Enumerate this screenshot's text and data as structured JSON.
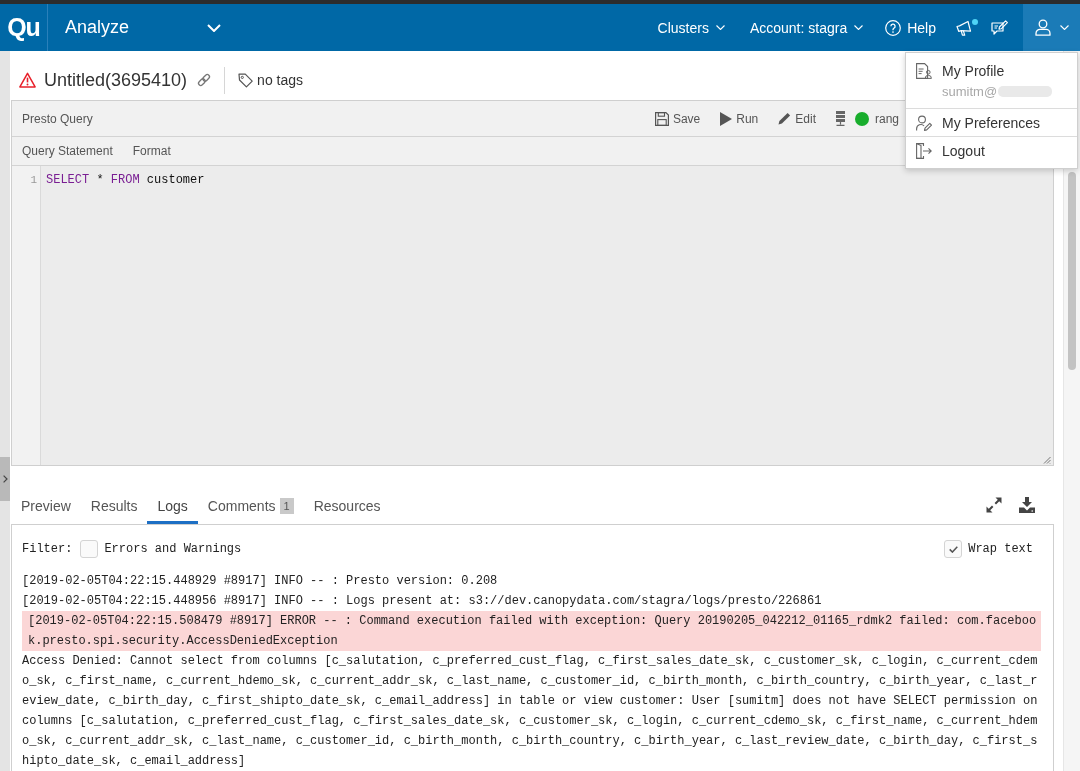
{
  "top_bar": {
    "logo": "Qu",
    "product": "Analyze",
    "menus": [
      {
        "label": "Clusters"
      },
      {
        "label": "Account: stagra"
      }
    ],
    "help": "Help",
    "unread_announcements": true
  },
  "command": {
    "failed": true,
    "title": "Untitled(3695410)",
    "tags": "no tags"
  },
  "editor": {
    "type": "Presto Query",
    "actions": [
      {
        "kind": "save",
        "label": "Save"
      },
      {
        "kind": "run",
        "label": "Run"
      },
      {
        "kind": "edit",
        "label": "Edit"
      }
    ],
    "cluster": {
      "running": true,
      "label": "rang"
    },
    "subtabs": [
      "Query Statement",
      "Format"
    ],
    "lines": [
      {
        "number": "1",
        "tokens": [
          {
            "kind": "keyword",
            "text": "SELECT"
          },
          {
            "kind": "plain",
            "text": " * "
          },
          {
            "kind": "keyword",
            "text": "FROM"
          },
          {
            "kind": "plain",
            "text": " customer"
          }
        ]
      }
    ]
  },
  "result_tabs": [
    {
      "label": "Preview",
      "selected": false
    },
    {
      "label": "Results",
      "selected": false
    },
    {
      "label": "Logs",
      "selected": true
    },
    {
      "label": "Comments",
      "selected": false,
      "badge": "1"
    },
    {
      "label": "Resources",
      "selected": false
    }
  ],
  "logs": {
    "filter_label": "Filter:",
    "errors_only": {
      "label": "Errors and Warnings",
      "checked": false
    },
    "wrap_text": {
      "label": "Wrap text",
      "checked": true
    },
    "entries": [
      {
        "kind": "info",
        "text": "[2019-02-05T04:22:15.448929 #8917] INFO -- : Presto version: 0.208"
      },
      {
        "kind": "info",
        "text": "[2019-02-05T04:22:15.448956 #8917] INFO -- : Logs present at: s3://dev.canopydata.com/stagra/logs/presto/226861"
      },
      {
        "kind": "error",
        "text": "[2019-02-05T04:22:15.508479 #8917] ERROR -- : Command execution failed with exception: Query 20190205_042212_01165_rdmk2 failed: com.facebook.presto.spi.security.AccessDeniedException"
      },
      {
        "kind": "message",
        "text": "Access Denied: Cannot select from columns [c_salutation, c_preferred_cust_flag, c_first_sales_date_sk, c_customer_sk, c_login, c_current_cdemo_sk, c_first_name, c_current_hdemo_sk, c_current_addr_sk, c_last_name, c_customer_id, c_birth_month, c_birth_country, c_birth_year, c_last_review_date, c_birth_day, c_first_shipto_date_sk, c_email_address] in table or view customer: User [sumitm] does not have SELECT permission on columns [c_salutation, c_preferred_cust_flag, c_first_sales_date_sk, c_customer_sk, c_login, c_current_cdemo_sk, c_first_name, c_current_hdemo_sk, c_current_addr_sk, c_last_name, c_customer_id, c_birth_month, c_birth_country, c_birth_year, c_last_review_date, c_birth_day, c_first_shipto_date_sk, c_email_address]"
      }
    ]
  },
  "user_menu": {
    "open": true,
    "items": [
      {
        "kind": "profile",
        "label": "My Profile",
        "email": "sumitm@"
      },
      {
        "kind": "preferences",
        "label": "My Preferences"
      },
      {
        "kind": "logout",
        "label": "Logout"
      }
    ]
  }
}
